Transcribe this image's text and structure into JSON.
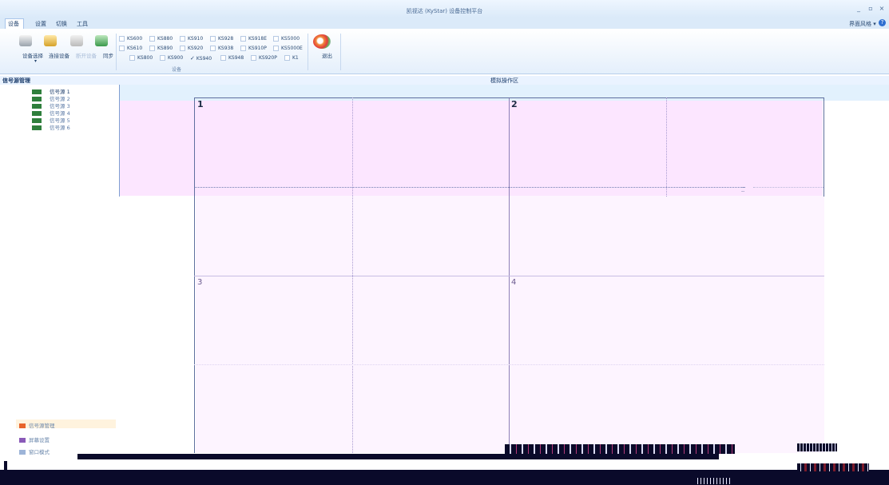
{
  "window": {
    "title": "凯视达 (KyStar) 设备控制平台",
    "controls": [
      "_",
      "▫",
      "×"
    ]
  },
  "menu_tabs": [
    "设备",
    "设置",
    "切换",
    "工具"
  ],
  "style_menu": "界面风格",
  "ribbon": {
    "buttons": [
      {
        "label": "设备选择"
      },
      {
        "label": "连接设备"
      },
      {
        "label": "断开设备"
      },
      {
        "label": "同步"
      }
    ],
    "models": [
      {
        "label": "KS600",
        "checked": false
      },
      {
        "label": "KS880",
        "checked": false
      },
      {
        "label": "KS910",
        "checked": false
      },
      {
        "label": "KS928",
        "checked": false
      },
      {
        "label": "KS918E",
        "checked": false
      },
      {
        "label": "KS5000",
        "checked": false
      },
      {
        "label": "KS610",
        "checked": false
      },
      {
        "label": "KS890",
        "checked": false
      },
      {
        "label": "KS920",
        "checked": false
      },
      {
        "label": "KS938",
        "checked": false
      },
      {
        "label": "KS910P",
        "checked": false
      },
      {
        "label": "KS5000E",
        "checked": false
      },
      {
        "label": "KS800",
        "checked": false
      },
      {
        "label": "KS900",
        "checked": false
      },
      {
        "label": "KS940",
        "checked": true
      },
      {
        "label": "KS948",
        "checked": false
      },
      {
        "label": "KS920P",
        "checked": false
      },
      {
        "label": "K1",
        "checked": false
      }
    ],
    "group_label": "设备",
    "exit_label": "退出"
  },
  "left_panel": {
    "title": "信号源管理",
    "sources": [
      "信号源 1",
      "信号源 2",
      "信号源 3",
      "信号源 4",
      "信号源 5",
      "信号源 6"
    ],
    "nav": [
      "信号源管理",
      "屏幕设置",
      "窗口模式"
    ]
  },
  "sim_area": {
    "title": "模拟操作区",
    "cells": [
      "1",
      "2",
      "3",
      "4"
    ]
  },
  "colors": {
    "pink": "#fce6ff",
    "sim_band": "#e2f1fd",
    "header": "#eaf3ff"
  }
}
